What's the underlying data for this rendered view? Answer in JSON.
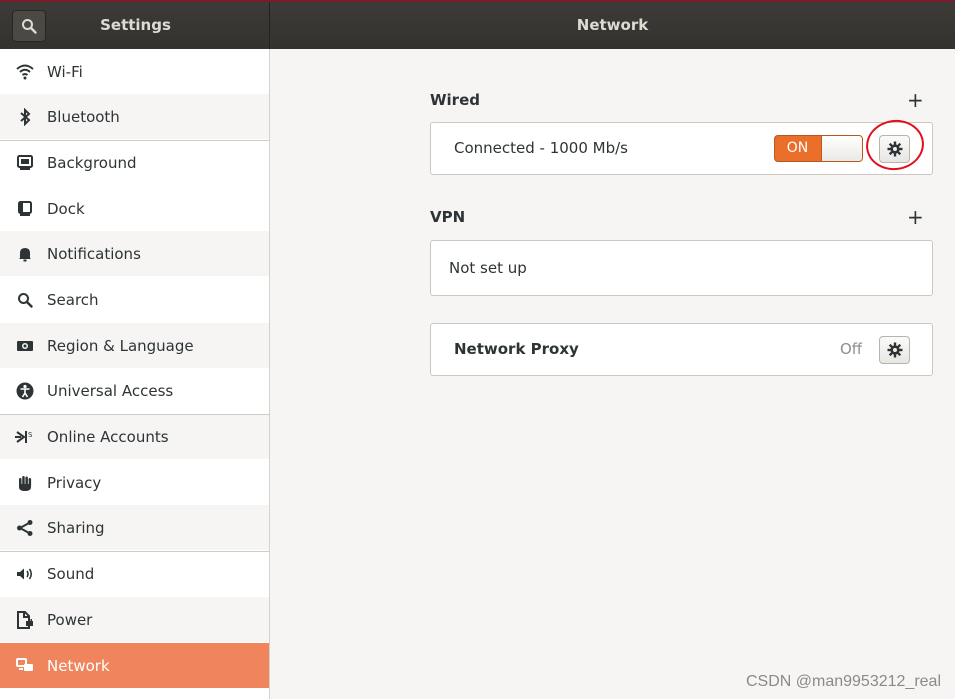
{
  "header": {
    "left_title": "Settings",
    "right_title": "Network"
  },
  "sidebar": {
    "items": [
      {
        "label": "Wi-Fi",
        "icon": "wifi-icon"
      },
      {
        "label": "Bluetooth",
        "icon": "bluetooth-icon"
      },
      {
        "label": "Background",
        "icon": "background-icon"
      },
      {
        "label": "Dock",
        "icon": "dock-icon"
      },
      {
        "label": "Notifications",
        "icon": "bell-icon"
      },
      {
        "label": "Search",
        "icon": "search-icon"
      },
      {
        "label": "Region & Language",
        "icon": "flag-icon"
      },
      {
        "label": "Universal Access",
        "icon": "accessibility-icon"
      },
      {
        "label": "Online Accounts",
        "icon": "online-accounts-icon"
      },
      {
        "label": "Privacy",
        "icon": "hand-icon"
      },
      {
        "label": "Sharing",
        "icon": "share-icon"
      },
      {
        "label": "Sound",
        "icon": "speaker-icon"
      },
      {
        "label": "Power",
        "icon": "power-icon"
      },
      {
        "label": "Network",
        "icon": "network-icon",
        "active": true
      }
    ]
  },
  "main": {
    "wired": {
      "title": "Wired",
      "add": "+",
      "status": "Connected - 1000 Mb/s",
      "toggle": "ON"
    },
    "vpn": {
      "title": "VPN",
      "add": "+",
      "status": "Not set up"
    },
    "proxy": {
      "title": "Network Proxy",
      "state": "Off"
    }
  },
  "watermark": "CSDN @man9953212_real",
  "colors": {
    "accent": "#e96f2b",
    "active_item": "#f0845c",
    "header": "#3c3b37",
    "annotation": "#e0101c"
  }
}
